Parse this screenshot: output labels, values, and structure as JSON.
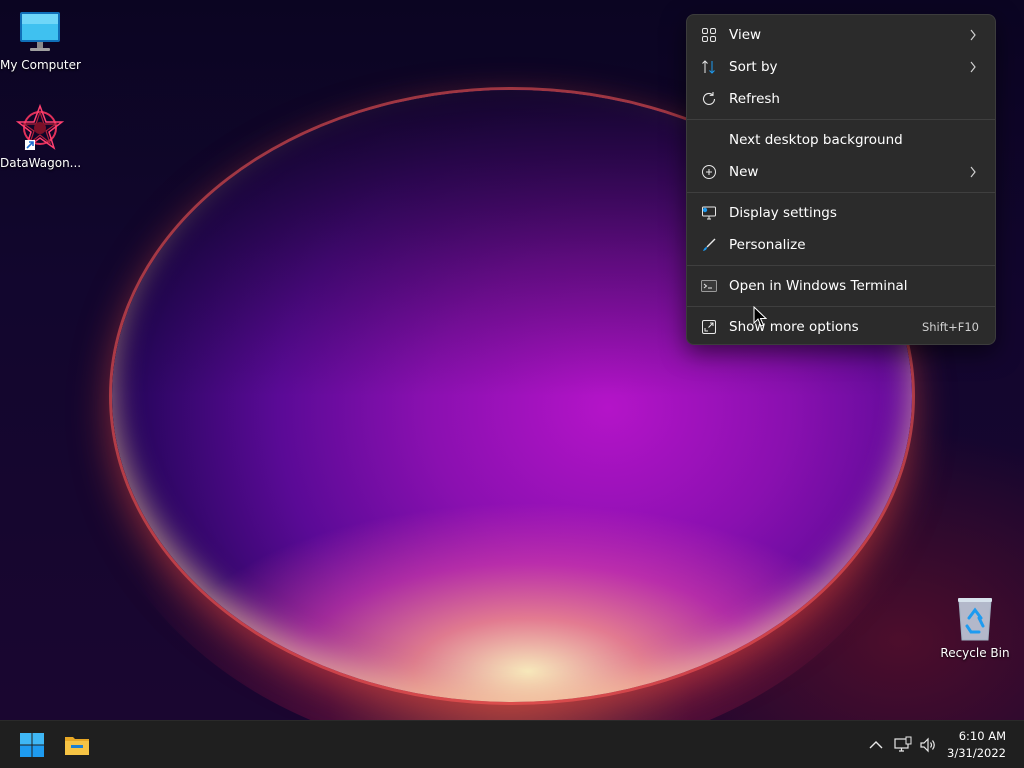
{
  "desktop": {
    "icons": [
      {
        "label": "My Computer",
        "icon": "computer-icon"
      },
      {
        "label": "DataWagon...",
        "icon": "datawagon-shortcut-icon"
      },
      {
        "label": "Recycle Bin",
        "icon": "recycle-bin-icon"
      }
    ]
  },
  "context_menu": {
    "items": [
      {
        "label": "View",
        "icon": "grid-icon",
        "submenu": true
      },
      {
        "label": "Sort by",
        "icon": "sort-icon",
        "submenu": true
      },
      {
        "label": "Refresh",
        "icon": "refresh-icon"
      },
      {
        "label": "Next desktop background"
      },
      {
        "label": "New",
        "icon": "plus-circle-icon",
        "submenu": true
      },
      {
        "label": "Display settings",
        "icon": "display-icon"
      },
      {
        "label": "Personalize",
        "icon": "brush-icon"
      },
      {
        "label": "Open in Windows Terminal",
        "icon": "terminal-icon"
      },
      {
        "label": "Show more options",
        "icon": "expand-icon",
        "shortcut": "Shift+F10"
      }
    ]
  },
  "taskbar": {
    "start_icon": "windows-logo-icon",
    "pinned": [
      "file-explorer-icon"
    ],
    "tray": [
      "chevron-up-icon",
      "network-icon",
      "volume-icon"
    ],
    "time": "6:10 AM",
    "date": "3/31/2022"
  },
  "colors": {
    "menu_bg": "#2b2b2b",
    "taskbar_bg": "#1f1f1f",
    "accent_blue": "#1e9bf0",
    "folder_yellow": "#f6c344"
  }
}
